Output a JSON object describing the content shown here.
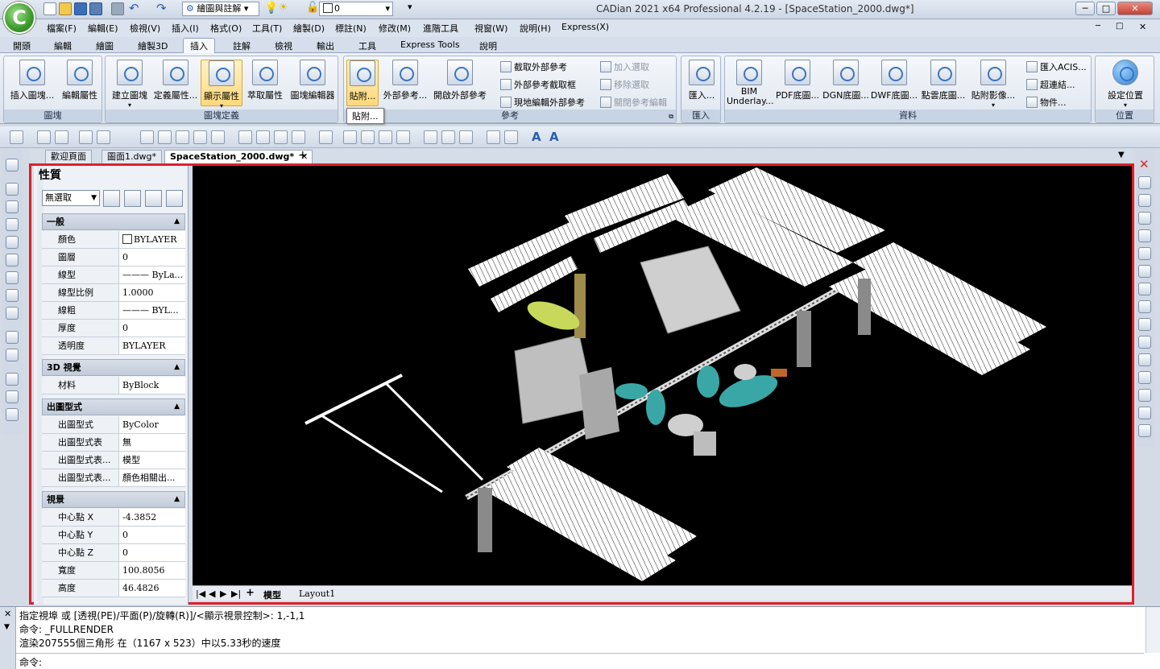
{
  "window": {
    "title": "CADian 2021 x64 Professional 4.2.19 - [SpaceStation_2000.dwg*]",
    "workspace": "繪圖與註解",
    "layer": "0",
    "controls": {
      "minimize": "─",
      "maximize": "□",
      "close": "✕"
    }
  },
  "menu": [
    "檔案(F)",
    "編輯(E)",
    "檢視(V)",
    "插入(I)",
    "格式(O)",
    "工具(T)",
    "繪製(D)",
    "標註(N)",
    "修改(M)",
    "進階工具",
    "視窗(W)",
    "說明(H)",
    "Express(X)"
  ],
  "ribbon_tabs": [
    "開頭",
    "編輯",
    "繪圖",
    "繪製3D",
    "插入",
    "註解",
    "檢視",
    "輸出",
    "工具",
    "Express Tools",
    "說明"
  ],
  "ribbon_active_tab": "插入",
  "ribbon": {
    "block_group": {
      "title": "圖塊",
      "insert_block": "插入圖塊...",
      "edit_attr": "編輯屬性"
    },
    "blockdef_group": {
      "title": "圖塊定義",
      "create_block": "建立圖塊",
      "define_attr": "定義屬性...",
      "show_attr": "顯示屬性",
      "extract_attr": "萃取屬性",
      "block_editor": "圖塊編輯器"
    },
    "reference_group": {
      "title": "參考",
      "attach": "貼附...",
      "xref": "外部參考...",
      "open_xref": "開啟外部參考",
      "clip_xref": "截取外部參考",
      "xref_clip_frame": "外部參考截取框",
      "edit_in_place": "現地編輯外部參考",
      "add_select": "加入選取",
      "remove_select": "移除選取",
      "close_ref_edit": "關閉參考編輯",
      "tooltip": "貼附..."
    },
    "import_group": {
      "title": "匯入",
      "import": "匯入..."
    },
    "data_group": {
      "title": "資料",
      "bim": "BIM\nUnderlay...",
      "pdf": "PDF底圖...",
      "dgn": "DGN底圖...",
      "dwf": "DWF底圖...",
      "point_cloud": "點雲底圖...",
      "attach_image": "貼附影像...",
      "import_acis": "匯入ACIS...",
      "hyperlink": "超連結...",
      "object": "物件..."
    },
    "location_group": {
      "title": "位置",
      "set_location": "設定位置"
    }
  },
  "doc_tabs": [
    "歡迎頁面",
    "圖面1.dwg*",
    "SpaceStation_2000.dwg*"
  ],
  "doc_tab_add": "+",
  "properties": {
    "title": "性質",
    "selection": "無選取",
    "sections": [
      {
        "name": "一般",
        "rows": [
          {
            "k": "顏色",
            "v": "BYLAYER"
          },
          {
            "k": "圖層",
            "v": "0"
          },
          {
            "k": "線型",
            "v": "——— ByLa..."
          },
          {
            "k": "線型比例",
            "v": "1.0000"
          },
          {
            "k": "線粗",
            "v": "——— BYL..."
          },
          {
            "k": "厚度",
            "v": "0"
          },
          {
            "k": "透明度",
            "v": "BYLAYER"
          }
        ]
      },
      {
        "name": "3D 視覺",
        "rows": [
          {
            "k": "材料",
            "v": "ByBlock"
          }
        ]
      },
      {
        "name": "出圖型式",
        "rows": [
          {
            "k": "出圖型式",
            "v": "ByColor"
          },
          {
            "k": "出圖型式表",
            "v": "無"
          },
          {
            "k": "出圖型式表...",
            "v": "模型"
          },
          {
            "k": "出圖型式表...",
            "v": "顏色相關出..."
          }
        ]
      },
      {
        "name": "視景",
        "rows": [
          {
            "k": "中心點 X",
            "v": "-4.3852"
          },
          {
            "k": "中心點 Y",
            "v": "0"
          },
          {
            "k": "中心點 Z",
            "v": "0"
          },
          {
            "k": "寬度",
            "v": "100.8056"
          },
          {
            "k": "高度",
            "v": "46.4826"
          }
        ]
      }
    ]
  },
  "layout_tabs": {
    "model": "模型",
    "layout1": "Layout1"
  },
  "command": {
    "history": [
      "指定視埠 或 [透視(PE)/平面(P)/旋轉(R)]/<顯示視景控制>: 1,-1,1",
      "命令: _FULLRENDER",
      "渲染207555個三角形 在（1167 x 523）中以5.33秒的速度"
    ],
    "prompt": "命令:"
  },
  "colors": {
    "accent_frame": "#e0202a",
    "canvas_bg": "#000000"
  }
}
